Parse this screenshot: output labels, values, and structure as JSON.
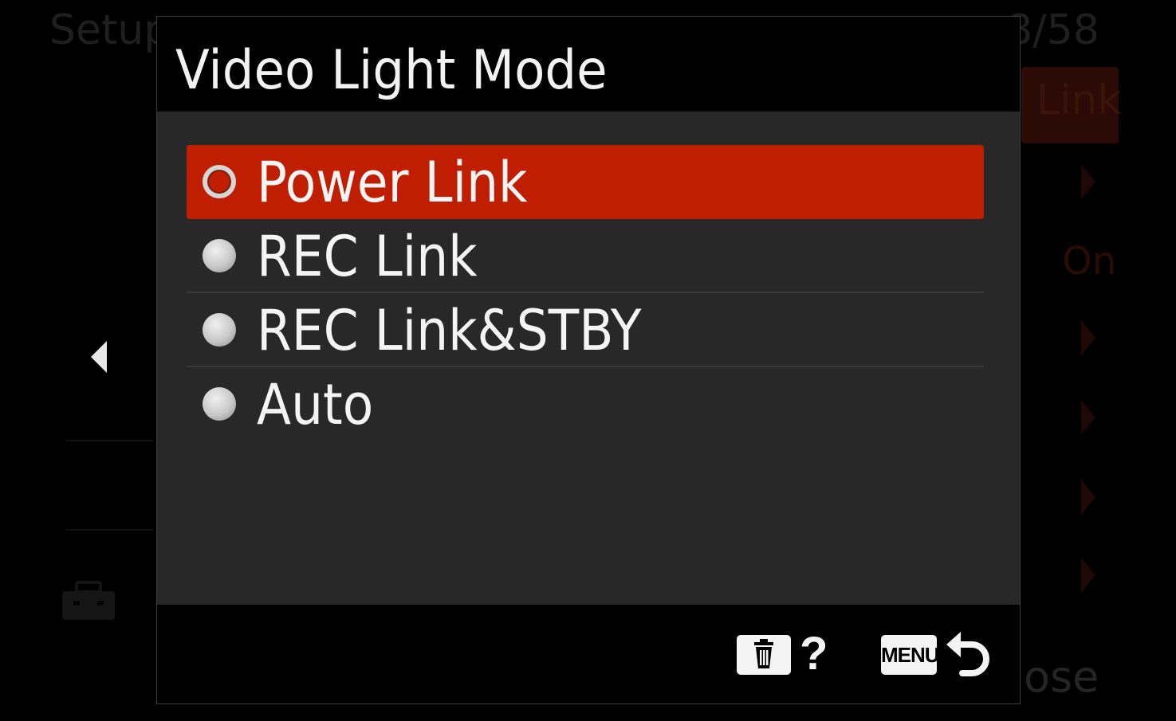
{
  "background_menu": {
    "title": "Setup",
    "page": "8/58",
    "selected_value": "Link",
    "value_on": "On",
    "close_hint": "ose"
  },
  "dialog": {
    "title": "Video Light Mode",
    "options": [
      {
        "label": "Power Link",
        "selected": true
      },
      {
        "label": "REC Link",
        "selected": false
      },
      {
        "label": "REC Link&STBY",
        "selected": false
      },
      {
        "label": "Auto",
        "selected": false
      }
    ],
    "footer": {
      "help_mark": "?",
      "menu_label": "MENU",
      "delete_icon": "trash-icon",
      "back_icon": "return-arrow-icon"
    }
  },
  "colors": {
    "selected_bg": "#c01e00",
    "panel_bg": "#282828",
    "text": "#f4f4f4"
  }
}
